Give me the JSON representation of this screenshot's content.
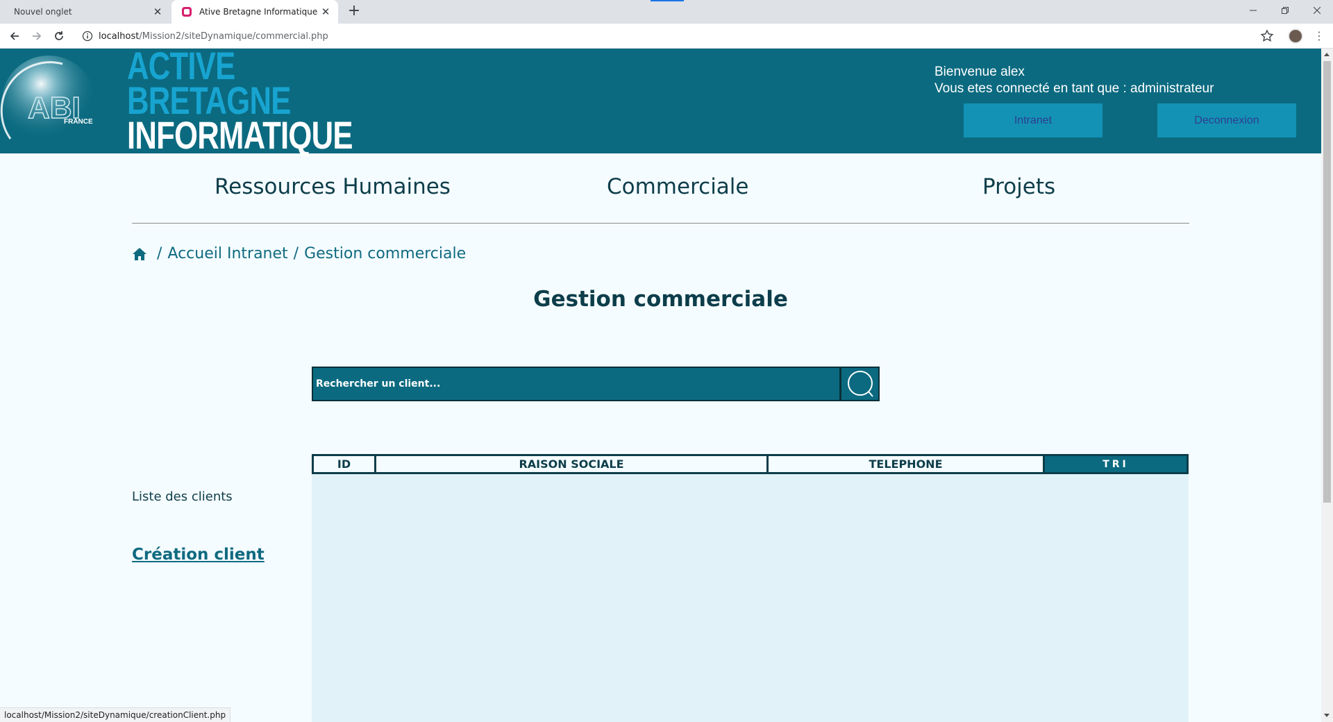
{
  "browser": {
    "tabs": [
      {
        "title": "Nouvel onglet",
        "active": false
      },
      {
        "title": "Ative Bretagne Informatique",
        "active": true
      }
    ],
    "url_host": "localhost",
    "url_path": "/Mission2/siteDynamique/commercial.php",
    "status_url": "localhost/Mission2/siteDynamique/creationClient.php"
  },
  "header": {
    "logo_text": "ABI",
    "logo_sub": "FRANCE",
    "brand_line1": "ACTIVE",
    "brand_line2": "BRETAGNE",
    "brand_line3": "INFORMATIQUE",
    "welcome_line1": "Bienvenue alex",
    "welcome_line2": "Vous etes connecté en tant que : administrateur",
    "intranet_label": "Intranet",
    "logout_label": "Deconnexion"
  },
  "nav": {
    "items": [
      "Ressources Humaines",
      "Commerciale",
      "Projets"
    ]
  },
  "breadcrumb": {
    "sep1": "/",
    "home_label": "Accueil Intranet",
    "sep2": "/",
    "current": "Gestion commerciale"
  },
  "page": {
    "title": "Gestion commerciale"
  },
  "search": {
    "placeholder": "Rechercher un client..."
  },
  "sidebar": {
    "list_label": "Liste des clients",
    "create_link": "Création client"
  },
  "table": {
    "headers": [
      "ID",
      "RAISON SOCIALE",
      "TELEPHONE",
      "TRI"
    ],
    "rows": []
  },
  "colors": {
    "header_bg": "#0b6a80",
    "brand_blue": "#18a4d0",
    "button_bg": "#1392b6",
    "text_dark": "#0d3d4a",
    "page_bg": "#f5fcff",
    "table_bg": "#e1f3f8"
  }
}
